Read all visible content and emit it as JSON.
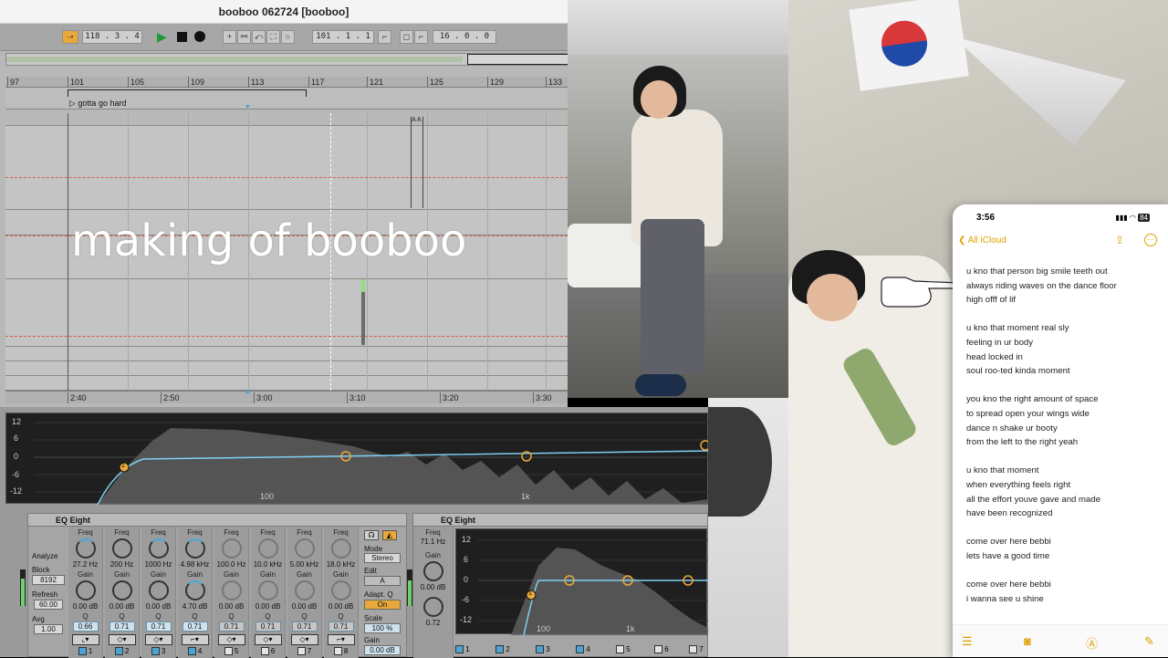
{
  "daw": {
    "window_title": "booboo 062724  [booboo]",
    "transport": {
      "position": "118 .  3 .  4",
      "loop_start": "101 .  1 .  1",
      "loop_length": "16 .  0 .  0"
    },
    "bar_ruler": [
      "97",
      "101",
      "105",
      "109",
      "113",
      "117",
      "121",
      "125",
      "129",
      "133"
    ],
    "locator_label": "gotta go hard",
    "clip_markers": "A A",
    "time_ruler": [
      "2:40",
      "2:50",
      "3:00",
      "3:10",
      "3:20",
      "3:30"
    ],
    "overlay_title": "making of booboo",
    "spectrum": {
      "db_ticks": [
        "12",
        "6",
        "0",
        "-6",
        "-12"
      ],
      "freq_ticks": [
        "100",
        "1k"
      ],
      "node_label": "1"
    },
    "eq_device_1": {
      "title": "EQ Eight",
      "analyze_label": "Analyze",
      "block_label": "Block",
      "block_value": "8192",
      "refresh_label": "Refresh",
      "refresh_value": "60.00",
      "avg_label": "Avg",
      "avg_value": "1.00",
      "bands": [
        {
          "freq_label": "Freq",
          "freq": "27.2 Hz",
          "gain_label": "Gain",
          "gain": "0.00 dB",
          "q_label": "Q",
          "q": "0.66",
          "num": "1",
          "on": true
        },
        {
          "freq_label": "Freq",
          "freq": "200 Hz",
          "gain_label": "Gain",
          "gain": "0.00 dB",
          "q_label": "Q",
          "q": "0.71",
          "num": "2",
          "on": true
        },
        {
          "freq_label": "Freq",
          "freq": "1000 Hz",
          "gain_label": "Gain",
          "gain": "0.00 dB",
          "q_label": "Q",
          "q": "0.71",
          "num": "3",
          "on": true
        },
        {
          "freq_label": "Freq",
          "freq": "4.98 kHz",
          "gain_label": "Gain",
          "gain": "4.70 dB",
          "q_label": "Q",
          "q": "0.71",
          "num": "4",
          "on": true
        },
        {
          "freq_label": "Freq",
          "freq": "100.0 Hz",
          "gain_label": "Gain",
          "gain": "0.00 dB",
          "q_label": "Q",
          "q": "0.71",
          "num": "5",
          "on": false
        },
        {
          "freq_label": "Freq",
          "freq": "10.0 kHz",
          "gain_label": "Gain",
          "gain": "0.00 dB",
          "q_label": "Q",
          "q": "0.71",
          "num": "6",
          "on": false
        },
        {
          "freq_label": "Freq",
          "freq": "5.00 kHz",
          "gain_label": "Gain",
          "gain": "0.00 dB",
          "q_label": "Q",
          "q": "0.71",
          "num": "7",
          "on": false
        },
        {
          "freq_label": "Freq",
          "freq": "18.0 kHz",
          "gain_label": "Gain",
          "gain": "0.00 dB",
          "q_label": "Q",
          "q": "0.71",
          "num": "8",
          "on": false
        }
      ],
      "mode_label": "Mode",
      "mode_value": "Stereo",
      "edit_label": "Edit",
      "edit_value": "A",
      "adapt_label": "Adapt. Q",
      "adapt_value": "On",
      "scale_label": "Scale",
      "scale_value": "100 %",
      "gain_label": "Gain",
      "gain_value": "0.00 dB"
    },
    "eq_device_2": {
      "title": "EQ Eight",
      "freq_label": "Freq",
      "freq": "71.1 Hz",
      "gain_label": "Gain",
      "gain": "0.00 dB",
      "q_label": "Q",
      "q": "0.72",
      "db_ticks": [
        "12",
        "6",
        "0",
        "-6",
        "-12"
      ],
      "freq_ticks": [
        "100",
        "1k"
      ],
      "node_label": "1",
      "band_nums": [
        "1",
        "2",
        "3",
        "4",
        "5",
        "6",
        "7"
      ]
    }
  },
  "phone": {
    "time": "3:56",
    "battery": "84",
    "back_label": "All iCloud",
    "stanzas": [
      [
        "u kno that person big smile teeth out",
        "always riding waves on the dance floor",
        "high offf of lif"
      ],
      [
        "u kno that moment real sly",
        "feeling in ur body",
        "head locked in",
        "soul roo-ted kinda moment"
      ],
      [
        "you kno the right amount of space",
        "to spread open your wings wide",
        "dance n shake ur booty",
        "from the left to the right yeah"
      ],
      [
        "u kno that moment",
        "when everything feels right",
        "all the effort youve gave and made",
        "have been recognized"
      ],
      [
        "come over here bebbi",
        "lets have a good time"
      ],
      [
        "come over here bebbi",
        "i wanna see u shine"
      ]
    ]
  },
  "colors": {
    "accent_orange": "#e9a93a",
    "eq_blue": "#4aa3d3",
    "ios_yellow": "#e0a000"
  }
}
